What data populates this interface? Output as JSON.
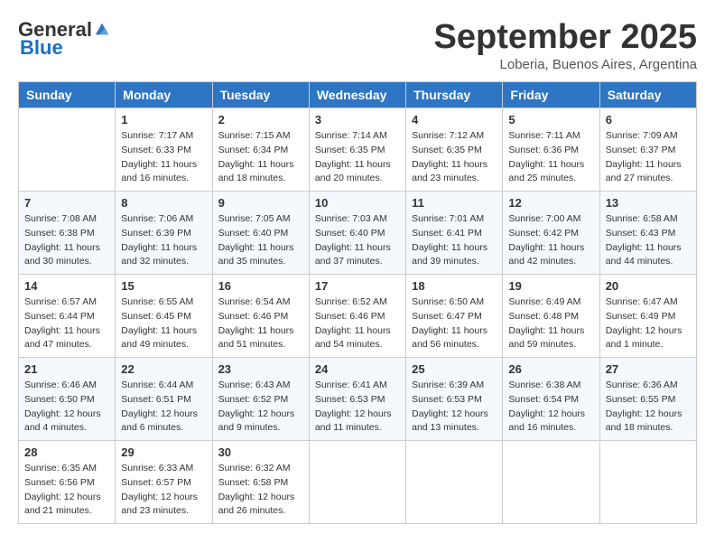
{
  "logo": {
    "general": "General",
    "blue": "Blue"
  },
  "title": "September 2025",
  "subtitle": "Loberia, Buenos Aires, Argentina",
  "days_of_week": [
    "Sunday",
    "Monday",
    "Tuesday",
    "Wednesday",
    "Thursday",
    "Friday",
    "Saturday"
  ],
  "weeks": [
    [
      {
        "day": "",
        "info": ""
      },
      {
        "day": "1",
        "info": "Sunrise: 7:17 AM\nSunset: 6:33 PM\nDaylight: 11 hours\nand 16 minutes."
      },
      {
        "day": "2",
        "info": "Sunrise: 7:15 AM\nSunset: 6:34 PM\nDaylight: 11 hours\nand 18 minutes."
      },
      {
        "day": "3",
        "info": "Sunrise: 7:14 AM\nSunset: 6:35 PM\nDaylight: 11 hours\nand 20 minutes."
      },
      {
        "day": "4",
        "info": "Sunrise: 7:12 AM\nSunset: 6:35 PM\nDaylight: 11 hours\nand 23 minutes."
      },
      {
        "day": "5",
        "info": "Sunrise: 7:11 AM\nSunset: 6:36 PM\nDaylight: 11 hours\nand 25 minutes."
      },
      {
        "day": "6",
        "info": "Sunrise: 7:09 AM\nSunset: 6:37 PM\nDaylight: 11 hours\nand 27 minutes."
      }
    ],
    [
      {
        "day": "7",
        "info": "Sunrise: 7:08 AM\nSunset: 6:38 PM\nDaylight: 11 hours\nand 30 minutes."
      },
      {
        "day": "8",
        "info": "Sunrise: 7:06 AM\nSunset: 6:39 PM\nDaylight: 11 hours\nand 32 minutes."
      },
      {
        "day": "9",
        "info": "Sunrise: 7:05 AM\nSunset: 6:40 PM\nDaylight: 11 hours\nand 35 minutes."
      },
      {
        "day": "10",
        "info": "Sunrise: 7:03 AM\nSunset: 6:40 PM\nDaylight: 11 hours\nand 37 minutes."
      },
      {
        "day": "11",
        "info": "Sunrise: 7:01 AM\nSunset: 6:41 PM\nDaylight: 11 hours\nand 39 minutes."
      },
      {
        "day": "12",
        "info": "Sunrise: 7:00 AM\nSunset: 6:42 PM\nDaylight: 11 hours\nand 42 minutes."
      },
      {
        "day": "13",
        "info": "Sunrise: 6:58 AM\nSunset: 6:43 PM\nDaylight: 11 hours\nand 44 minutes."
      }
    ],
    [
      {
        "day": "14",
        "info": "Sunrise: 6:57 AM\nSunset: 6:44 PM\nDaylight: 11 hours\nand 47 minutes."
      },
      {
        "day": "15",
        "info": "Sunrise: 6:55 AM\nSunset: 6:45 PM\nDaylight: 11 hours\nand 49 minutes."
      },
      {
        "day": "16",
        "info": "Sunrise: 6:54 AM\nSunset: 6:46 PM\nDaylight: 11 hours\nand 51 minutes."
      },
      {
        "day": "17",
        "info": "Sunrise: 6:52 AM\nSunset: 6:46 PM\nDaylight: 11 hours\nand 54 minutes."
      },
      {
        "day": "18",
        "info": "Sunrise: 6:50 AM\nSunset: 6:47 PM\nDaylight: 11 hours\nand 56 minutes."
      },
      {
        "day": "19",
        "info": "Sunrise: 6:49 AM\nSunset: 6:48 PM\nDaylight: 11 hours\nand 59 minutes."
      },
      {
        "day": "20",
        "info": "Sunrise: 6:47 AM\nSunset: 6:49 PM\nDaylight: 12 hours\nand 1 minute."
      }
    ],
    [
      {
        "day": "21",
        "info": "Sunrise: 6:46 AM\nSunset: 6:50 PM\nDaylight: 12 hours\nand 4 minutes."
      },
      {
        "day": "22",
        "info": "Sunrise: 6:44 AM\nSunset: 6:51 PM\nDaylight: 12 hours\nand 6 minutes."
      },
      {
        "day": "23",
        "info": "Sunrise: 6:43 AM\nSunset: 6:52 PM\nDaylight: 12 hours\nand 9 minutes."
      },
      {
        "day": "24",
        "info": "Sunrise: 6:41 AM\nSunset: 6:53 PM\nDaylight: 12 hours\nand 11 minutes."
      },
      {
        "day": "25",
        "info": "Sunrise: 6:39 AM\nSunset: 6:53 PM\nDaylight: 12 hours\nand 13 minutes."
      },
      {
        "day": "26",
        "info": "Sunrise: 6:38 AM\nSunset: 6:54 PM\nDaylight: 12 hours\nand 16 minutes."
      },
      {
        "day": "27",
        "info": "Sunrise: 6:36 AM\nSunset: 6:55 PM\nDaylight: 12 hours\nand 18 minutes."
      }
    ],
    [
      {
        "day": "28",
        "info": "Sunrise: 6:35 AM\nSunset: 6:56 PM\nDaylight: 12 hours\nand 21 minutes."
      },
      {
        "day": "29",
        "info": "Sunrise: 6:33 AM\nSunset: 6:57 PM\nDaylight: 12 hours\nand 23 minutes."
      },
      {
        "day": "30",
        "info": "Sunrise: 6:32 AM\nSunset: 6:58 PM\nDaylight: 12 hours\nand 26 minutes."
      },
      {
        "day": "",
        "info": ""
      },
      {
        "day": "",
        "info": ""
      },
      {
        "day": "",
        "info": ""
      },
      {
        "day": "",
        "info": ""
      }
    ]
  ]
}
